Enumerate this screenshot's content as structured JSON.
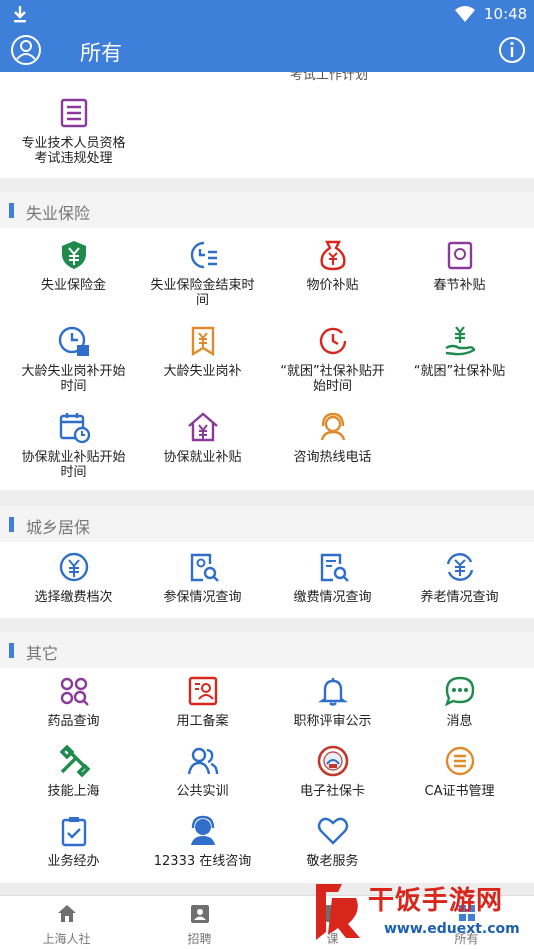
{
  "status": {
    "time": "10:48"
  },
  "appbar": {
    "title": "所有"
  },
  "top_section": {
    "cut_label": "考试工作计划",
    "items": [
      {
        "label": "专业技术人员资格考试违规处理",
        "icon": "document-list-icon"
      }
    ]
  },
  "unemployment": {
    "title": "失业保险",
    "items": [
      {
        "label": "失业保险金",
        "icon": "shield-yuan-icon"
      },
      {
        "label": "失业保险金结束时间",
        "icon": "clock-list-icon"
      },
      {
        "label": "物价补贴",
        "icon": "money-bag-icon"
      },
      {
        "label": "春节补贴",
        "icon": "red-envelope-icon"
      },
      {
        "label": "大龄失业岗补开始时间",
        "icon": "clock-calendar-icon"
      },
      {
        "label": "大龄失业岗补",
        "icon": "yuan-badge-icon"
      },
      {
        "label": "“就困”社保补贴开始时间",
        "icon": "clock-icon"
      },
      {
        "label": "“就困”社保补贴",
        "icon": "hand-yuan-icon"
      },
      {
        "label": "协保就业补贴开始时间",
        "icon": "calendar-clock-icon"
      },
      {
        "label": "协保就业补贴",
        "icon": "house-yuan-icon"
      },
      {
        "label": "咨询热线电话",
        "icon": "headset-icon"
      }
    ]
  },
  "urban_rural": {
    "title": "城乡居保",
    "items": [
      {
        "label": "选择缴费档次",
        "icon": "yuan-circle-icon"
      },
      {
        "label": "参保情况查询",
        "icon": "person-search-icon"
      },
      {
        "label": "缴费情况查询",
        "icon": "doc-search-icon"
      },
      {
        "label": "养老情况查询",
        "icon": "yuan-refresh-icon"
      }
    ]
  },
  "others": {
    "title": "其它",
    "items": [
      {
        "label": "药品查询",
        "icon": "pills-search-icon"
      },
      {
        "label": "用工备案",
        "icon": "id-card-icon"
      },
      {
        "label": "职称评审公示",
        "icon": "bell-icon"
      },
      {
        "label": "消息",
        "icon": "chat-bubble-icon"
      },
      {
        "label": "技能上海",
        "icon": "tools-icon"
      },
      {
        "label": "公共实训",
        "icon": "people-icon"
      },
      {
        "label": "电子社保卡",
        "icon": "seal-icon"
      },
      {
        "label": "CA证书管理",
        "icon": "list-circle-icon"
      },
      {
        "label": "业务经办",
        "icon": "clipboard-check-icon"
      },
      {
        "label": "12333 在线咨询",
        "icon": "operator-icon"
      },
      {
        "label": "敬老服务",
        "icon": "heart-icon"
      }
    ]
  },
  "tabs": [
    {
      "label": "上海人社",
      "icon": "home-icon"
    },
    {
      "label": "招聘",
      "icon": "badge-icon"
    },
    {
      "label": "课",
      "icon": "book-icon"
    },
    {
      "label": "所有",
      "icon": "grid-icon"
    }
  ],
  "watermark": {
    "brand": "干饭手游网",
    "url": "www.eduext.com"
  },
  "colors": {
    "primary": "#3d7fd9",
    "green": "#1e8a4c",
    "orange": "#e08a2a",
    "red": "#d9261c",
    "purple": "#8a3a9a",
    "blue": "#2f6fc9"
  }
}
